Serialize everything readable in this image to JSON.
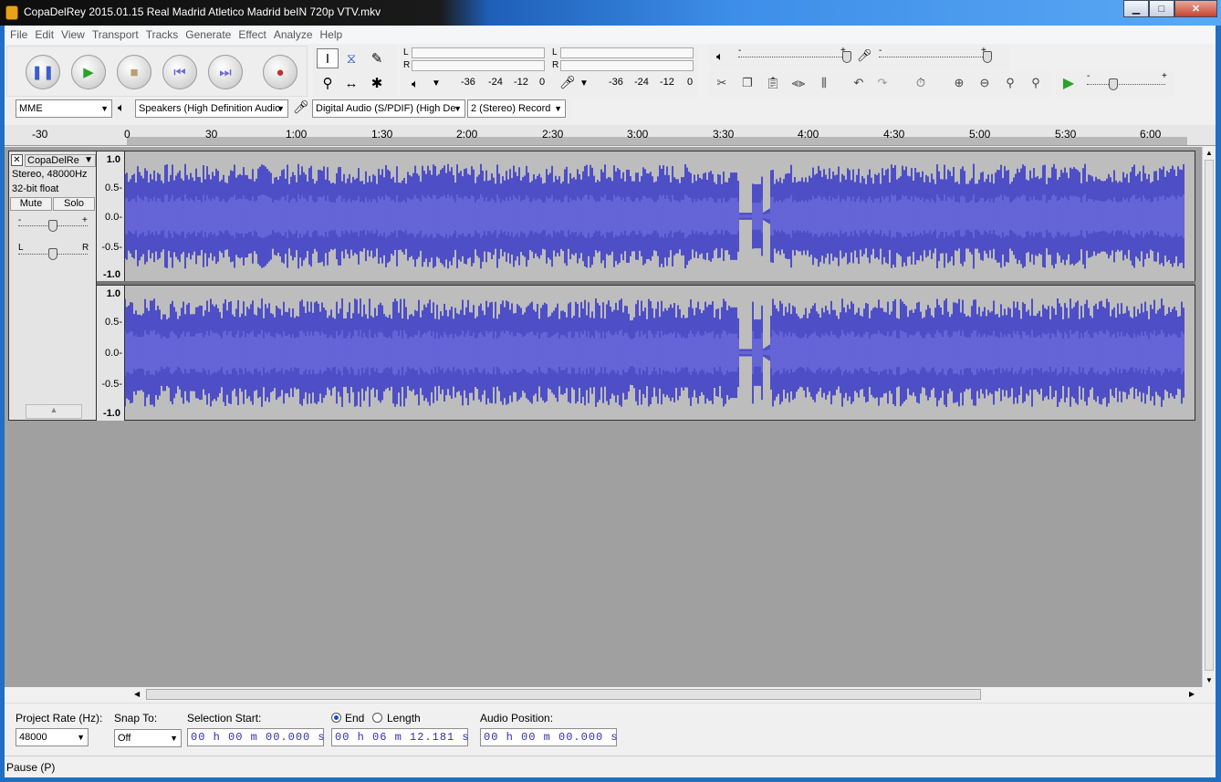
{
  "window": {
    "title": "CopaDelRey 2015.01.15 Real Madrid Atletico Madrid beIN 720p VTV.mkv",
    "minimize": "▁",
    "maximize": "□",
    "close": "✕"
  },
  "menu": [
    "File",
    "Edit",
    "View",
    "Transport",
    "Tracks",
    "Generate",
    "Effect",
    "Analyze",
    "Help"
  ],
  "meter": {
    "L": "L",
    "R": "R",
    "ticks": [
      "-36",
      "-24",
      "-12",
      "0"
    ],
    "slider_minus": "-",
    "slider_plus": "+"
  },
  "devices": {
    "host": "MME",
    "playback": "Speakers (High Definition Audio",
    "recording": "Digital Audio (S/PDIF) (High De",
    "channels": "2 (Stereo) Record"
  },
  "ruler": {
    "labels": [
      "-30",
      "0",
      "30",
      "1:00",
      "1:30",
      "2:00",
      "2:30",
      "3:00",
      "3:30",
      "4:00",
      "4:30",
      "5:00",
      "5:30",
      "6:00"
    ]
  },
  "track": {
    "name": "CopaDelRe",
    "format": "Stereo, 48000Hz",
    "bits": "32-bit float",
    "mute": "Mute",
    "solo": "Solo",
    "gain_minus": "-",
    "gain_plus": "+",
    "pan_left": "L",
    "pan_right": "R",
    "scale": [
      "1.0",
      "0.5-",
      "0.0-",
      "-0.5-",
      "-1.0"
    ],
    "wave_color": "#3232c8",
    "wave_color_light": "#6464dc"
  },
  "selection_toolbar": {
    "project_rate_label": "Project Rate (Hz):",
    "project_rate": "48000",
    "snap_label": "Snap To:",
    "snap_value": "Off",
    "sel_start_label": "Selection Start:",
    "sel_start": "00 h 00 m 00.000 s",
    "end_label": "End",
    "length_label": "Length",
    "end_value": "00 h 06 m 12.181 s",
    "audio_pos_label": "Audio Position:",
    "audio_pos": "00 h 00 m 00.000 s"
  },
  "status": "Pause (P)"
}
